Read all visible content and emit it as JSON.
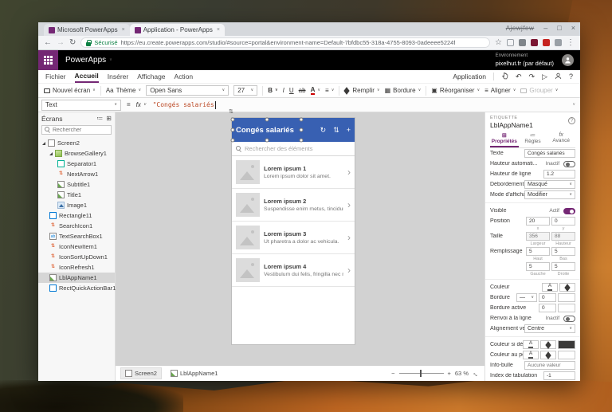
{
  "icons": {
    "chevron_down": "∨",
    "chevron_right": "›",
    "back": "←",
    "forward": "→",
    "reload": "↻",
    "star": "☆",
    "menu_dots": "⋮",
    "undo": "↶",
    "redo": "↷",
    "play": "▷",
    "help": "?",
    "close": "×",
    "maximize": "□",
    "minimize": "–",
    "plus": "+",
    "minus": "−",
    "sort": "⇅",
    "refresh": "↻",
    "list_view": "≔",
    "grid_view": "⊞",
    "border": "▦",
    "reorder": "▣",
    "align": "≡",
    "equals": "=",
    "arrow_pair": "⇅",
    "expand": "↔"
  },
  "browser": {
    "tabs": [
      {
        "title": "Microsoft PowerApps"
      },
      {
        "title": "Application - PowerApps"
      }
    ],
    "profile_name": "Ajewjfew",
    "security_label": "Sécurisé",
    "url": "https://eu.create.powerapps.com/studio/#source=portal&environment-name=Default-7bfdbc55-318a-4755-8093-0adeeee5224f"
  },
  "pa_header": {
    "brand": "PowerApps",
    "env_label": "Environnement",
    "env_value": "pixelhut.fr (par défaut)"
  },
  "menu": {
    "items": [
      "Fichier",
      "Accueil",
      "Insérer",
      "Affichage",
      "Action"
    ],
    "application_label": "Application"
  },
  "ribbon": {
    "new_screen": "Nouvel écran",
    "theme": "Thème",
    "theme_icon": "Aa",
    "font_name": "Open Sans",
    "font_size": "27",
    "bold": "B",
    "italic": "I",
    "underline": "U",
    "strike": "ab",
    "font_color": "A",
    "fill": "Remplir",
    "border": "Bordure",
    "reorder": "Réorganiser",
    "align": "Aligner",
    "group": "Grouper"
  },
  "formula_bar": {
    "property": "Text",
    "fx_label": "fx",
    "formula": "\"Congés salariés"
  },
  "screens_panel": {
    "title": "Écrans",
    "search_placeholder": "Rechercher",
    "tree": [
      {
        "label": "Screen2"
      },
      {
        "label": "BrowseGallery1"
      },
      {
        "label": "Separator1"
      },
      {
        "label": "NextArrow1"
      },
      {
        "label": "Subtitle1"
      },
      {
        "label": "Title1"
      },
      {
        "label": "Image1"
      },
      {
        "label": "Rectangle11"
      },
      {
        "label": "SearchIcon1"
      },
      {
        "label": "TextSearchBox1"
      },
      {
        "label": "IconNewItem1"
      },
      {
        "label": "IconSortUpDown1"
      },
      {
        "label": "IconRefresh1"
      },
      {
        "label": "LblAppName1"
      },
      {
        "label": "RectQuickActionBar1"
      }
    ]
  },
  "phone": {
    "title": "Congés salariés",
    "search_placeholder": "Rechercher des éléments",
    "items": [
      {
        "title": "Lorem ipsum 1",
        "subtitle": "Lorem ipsum dolor sit amet."
      },
      {
        "title": "Lorem ipsum 2",
        "subtitle": "Suspendisse enim metus, tincidunt"
      },
      {
        "title": "Lorem ipsum 3",
        "subtitle": "Ut pharetra a dolor ac vehicula."
      },
      {
        "title": "Lorem ipsum 4",
        "subtitle": "Vestibulum dui felis, fringilla nec mi"
      }
    ]
  },
  "properties": {
    "control_type": "ÉTIQUETTE",
    "control_name": "LblAppName1",
    "tabs": [
      "Propriétés",
      "Règles",
      "Avancé"
    ],
    "texte_label": "Texte",
    "texte_value": "Congés salariés",
    "auto_height_label": "Hauteur automati...",
    "auto_height_state": "Inactif",
    "line_height_label": "Hauteur de ligne",
    "line_height_value": "1.2",
    "overflow_label": "Débordement",
    "overflow_value": "Masqué",
    "display_mode_label": "Mode d'affichage",
    "display_mode_value": "Modifier",
    "visible_label": "Visible",
    "visible_state": "Actif",
    "position_label": "Position",
    "position_x": "20",
    "position_y": "0",
    "x_label": "x",
    "y_label": "y",
    "size_label": "Taille",
    "size_w": "356",
    "size_h": "88",
    "width_label": "Largeur",
    "height_label": "Hauteur",
    "padding_label": "Remplissage",
    "pad_top": "5",
    "pad_bottom": "5",
    "pad_left": "5",
    "pad_right": "5",
    "top_label": "Haut",
    "bottom_label": "Bas",
    "left_label": "Gauche",
    "right_label": "Droite",
    "color_label": "Couleur",
    "font_color_glyph": "A",
    "border_label": "Bordure",
    "border_style_value": "—",
    "border_width": "0",
    "border_active_label": "Bordure active",
    "border_active_width": "0",
    "wrap_label": "Renvoi à la ligne",
    "wrap_state": "Inactif",
    "valign_label": "Alignement vertical",
    "valign_value": "Centre",
    "disabled_color_label": "Couleur si désactivé",
    "hover_color_label": "Couleur au pointage",
    "tooltip_label": "Info-bulle",
    "tooltip_placeholder": "Aucune valeur",
    "tabindex_label": "Index de tabulation",
    "tabindex_value": "-1"
  },
  "status_bar": {
    "screen": "Screen2",
    "control": "LblAppName1",
    "zoom": "63 %"
  },
  "colors": {
    "brand_purple": "#742774",
    "app_header_blue": "#3860b2",
    "formula_string": "#bc4a26"
  }
}
